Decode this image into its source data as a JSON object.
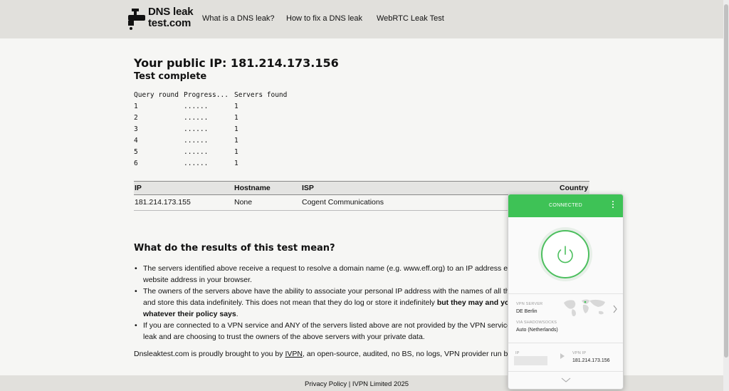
{
  "header": {
    "logo_line1": "DNS leak",
    "logo_line2": "test.com",
    "nav": [
      "What is a DNS leak?",
      "How to fix a DNS leak",
      "WebRTC Leak Test"
    ]
  },
  "main": {
    "ip_title": "Your public IP: 181.214.173.156",
    "status": "Test complete",
    "query_headers": [
      "Query round",
      "Progress...",
      "Servers found"
    ],
    "query_rows": [
      [
        "1",
        "......",
        "1"
      ],
      [
        "2",
        "......",
        "1"
      ],
      [
        "3",
        "......",
        "1"
      ],
      [
        "4",
        "......",
        "1"
      ],
      [
        "5",
        "......",
        "1"
      ],
      [
        "6",
        "......",
        "1"
      ]
    ],
    "table_headers": [
      "IP",
      "Hostname",
      "ISP",
      "Country"
    ],
    "table_rows": [
      [
        "181.214.173.155",
        "None",
        "Cogent Communications"
      ]
    ],
    "section_title": "What do the results of this test mean?",
    "bullet1_line1": "The servers identified above receive a request to resolve a domain name (e.g. www.eff.org) to an IP address every time you enter a",
    "bullet1_line2": "website address in your browser.",
    "bullet2_line1": "The owners of the servers above have the ability to associate your personal IP address with the names of all the sites you connect to",
    "bullet2_line2_a": "and store this data indefinitely. This does not mean that they do log or store it indefinitely ",
    "bullet2_line2_b": "but they may and you need to trust",
    "bullet2_line3": "whatever their policy says",
    "bullet2_line3_end": ".",
    "bullet3_line1": "If you are connected to a VPN service and ANY of the servers listed above are not provided by the VPN service then you have a DNS",
    "bullet3_line2": "leak and are choosing to trust the owners of the above servers with your private data.",
    "credit_a": "Dnsleaktest.com is proudly brought to you by ",
    "credit_link": "IVPN",
    "credit_b": ", an open-source, audited, no BS, no logs, VPN provider run by privacy advocates."
  },
  "footer": {
    "text": "Privacy Policy | IVPN Limited 2025"
  },
  "vpn": {
    "status": "CONNECTED",
    "server_label": "VPN SERVER",
    "server_value": "DE Berlin",
    "via_label": "VIA SHADOWSOCKS",
    "via_value": "Auto (Netherlands)",
    "ip_label": "IP",
    "vpn_ip_label": "VPN IP",
    "vpn_ip_value": "181.214.173.156",
    "accent_color": "#3ec256"
  }
}
